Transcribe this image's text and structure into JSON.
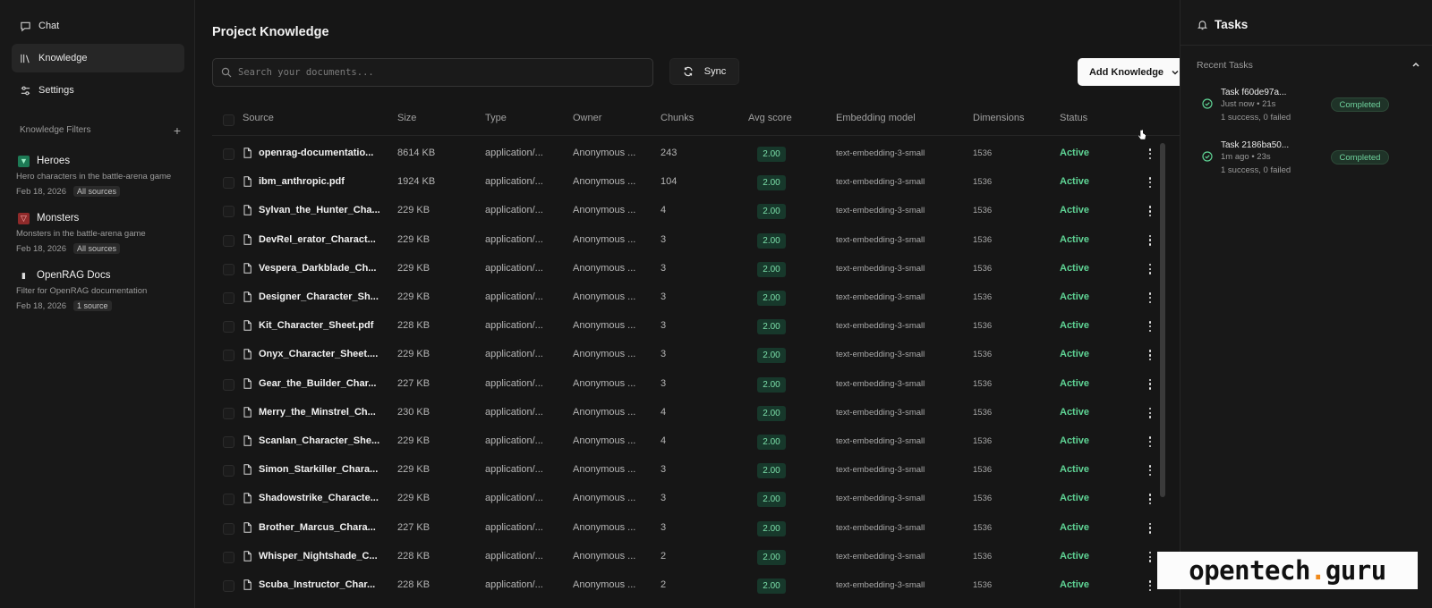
{
  "sidebar": {
    "nav": [
      {
        "label": "Chat",
        "icon": "chat-bubble-icon"
      },
      {
        "label": "Knowledge",
        "icon": "library-icon"
      },
      {
        "label": "Settings",
        "icon": "sliders-icon"
      }
    ],
    "filters_heading": "Knowledge Filters",
    "filters": [
      {
        "title": "Heroes",
        "description": "Hero characters in the battle-arena game",
        "date": "Feb 18, 2026",
        "sources": "All sources",
        "icon": "hero-filter-icon",
        "color": "#1d7a55"
      },
      {
        "title": "Monsters",
        "description": "Monsters in the battle-arena game",
        "date": "Feb 18, 2026",
        "sources": "All sources",
        "icon": "monster-filter-icon",
        "color": "#8f2a2a"
      },
      {
        "title": "OpenRAG Docs",
        "description": "Filter for OpenRAG documentation",
        "date": "Feb 18, 2026",
        "sources": "1 source",
        "icon": "book-icon",
        "color": "#2a2a2a"
      }
    ]
  },
  "main": {
    "title": "Project Knowledge",
    "search_placeholder": "Search your documents...",
    "sync_label": "Sync",
    "add_label": "Add Knowledge",
    "columns": [
      "Source",
      "Size",
      "Type",
      "Owner",
      "Chunks",
      "Avg score",
      "Embedding model",
      "Dimensions",
      "Status"
    ],
    "rows": [
      {
        "source": "openrag-documentatio...",
        "size": "8614 KB",
        "type": "application/...",
        "owner": "Anonymous ...",
        "chunks": "243",
        "score": "2.00",
        "model": "text-embedding-3-small",
        "dims": "1536",
        "status": "Active"
      },
      {
        "source": "ibm_anthropic.pdf",
        "size": "1924 KB",
        "type": "application/...",
        "owner": "Anonymous ...",
        "chunks": "104",
        "score": "2.00",
        "model": "text-embedding-3-small",
        "dims": "1536",
        "status": "Active"
      },
      {
        "source": "Sylvan_the_Hunter_Cha...",
        "size": "229 KB",
        "type": "application/...",
        "owner": "Anonymous ...",
        "chunks": "4",
        "score": "2.00",
        "model": "text-embedding-3-small",
        "dims": "1536",
        "status": "Active"
      },
      {
        "source": "DevRel_erator_Charact...",
        "size": "229 KB",
        "type": "application/...",
        "owner": "Anonymous ...",
        "chunks": "3",
        "score": "2.00",
        "model": "text-embedding-3-small",
        "dims": "1536",
        "status": "Active"
      },
      {
        "source": "Vespera_Darkblade_Ch...",
        "size": "229 KB",
        "type": "application/...",
        "owner": "Anonymous ...",
        "chunks": "3",
        "score": "2.00",
        "model": "text-embedding-3-small",
        "dims": "1536",
        "status": "Active"
      },
      {
        "source": "Designer_Character_Sh...",
        "size": "229 KB",
        "type": "application/...",
        "owner": "Anonymous ...",
        "chunks": "3",
        "score": "2.00",
        "model": "text-embedding-3-small",
        "dims": "1536",
        "status": "Active"
      },
      {
        "source": "Kit_Character_Sheet.pdf",
        "size": "228 KB",
        "type": "application/...",
        "owner": "Anonymous ...",
        "chunks": "3",
        "score": "2.00",
        "model": "text-embedding-3-small",
        "dims": "1536",
        "status": "Active"
      },
      {
        "source": "Onyx_Character_Sheet....",
        "size": "229 KB",
        "type": "application/...",
        "owner": "Anonymous ...",
        "chunks": "3",
        "score": "2.00",
        "model": "text-embedding-3-small",
        "dims": "1536",
        "status": "Active"
      },
      {
        "source": "Gear_the_Builder_Char...",
        "size": "227 KB",
        "type": "application/...",
        "owner": "Anonymous ...",
        "chunks": "3",
        "score": "2.00",
        "model": "text-embedding-3-small",
        "dims": "1536",
        "status": "Active"
      },
      {
        "source": "Merry_the_Minstrel_Ch...",
        "size": "230 KB",
        "type": "application/...",
        "owner": "Anonymous ...",
        "chunks": "4",
        "score": "2.00",
        "model": "text-embedding-3-small",
        "dims": "1536",
        "status": "Active"
      },
      {
        "source": "Scanlan_Character_She...",
        "size": "229 KB",
        "type": "application/...",
        "owner": "Anonymous ...",
        "chunks": "4",
        "score": "2.00",
        "model": "text-embedding-3-small",
        "dims": "1536",
        "status": "Active"
      },
      {
        "source": "Simon_Starkiller_Chara...",
        "size": "229 KB",
        "type": "application/...",
        "owner": "Anonymous ...",
        "chunks": "3",
        "score": "2.00",
        "model": "text-embedding-3-small",
        "dims": "1536",
        "status": "Active"
      },
      {
        "source": "Shadowstrike_Characte...",
        "size": "229 KB",
        "type": "application/...",
        "owner": "Anonymous ...",
        "chunks": "3",
        "score": "2.00",
        "model": "text-embedding-3-small",
        "dims": "1536",
        "status": "Active"
      },
      {
        "source": "Brother_Marcus_Chara...",
        "size": "227 KB",
        "type": "application/...",
        "owner": "Anonymous ...",
        "chunks": "3",
        "score": "2.00",
        "model": "text-embedding-3-small",
        "dims": "1536",
        "status": "Active"
      },
      {
        "source": "Whisper_Nightshade_C...",
        "size": "228 KB",
        "type": "application/...",
        "owner": "Anonymous ...",
        "chunks": "2",
        "score": "2.00",
        "model": "text-embedding-3-small",
        "dims": "1536",
        "status": "Active"
      },
      {
        "source": "Scuba_Instructor_Char...",
        "size": "228 KB",
        "type": "application/...",
        "owner": "Anonymous ...",
        "chunks": "2",
        "score": "2.00",
        "model": "text-embedding-3-small",
        "dims": "1536",
        "status": "Active"
      }
    ]
  },
  "tasks": {
    "title": "Tasks",
    "recent_label": "Recent Tasks",
    "items": [
      {
        "name": "Task f60de97a...",
        "time": "Just now  • 21s",
        "result": "1 success, 0 failed",
        "status": "Completed"
      },
      {
        "name": "Task 2186ba50...",
        "time": "1m ago  • 23s",
        "result": "1 success, 0 failed",
        "status": "Completed"
      }
    ]
  },
  "watermark": {
    "left": "opentech",
    "dot": ".",
    "right": "guru"
  },
  "colors": {
    "background": "#161616",
    "status_active": "#5fd495",
    "score_bg": "#17382b",
    "badge_completed": "#6fd39d"
  }
}
